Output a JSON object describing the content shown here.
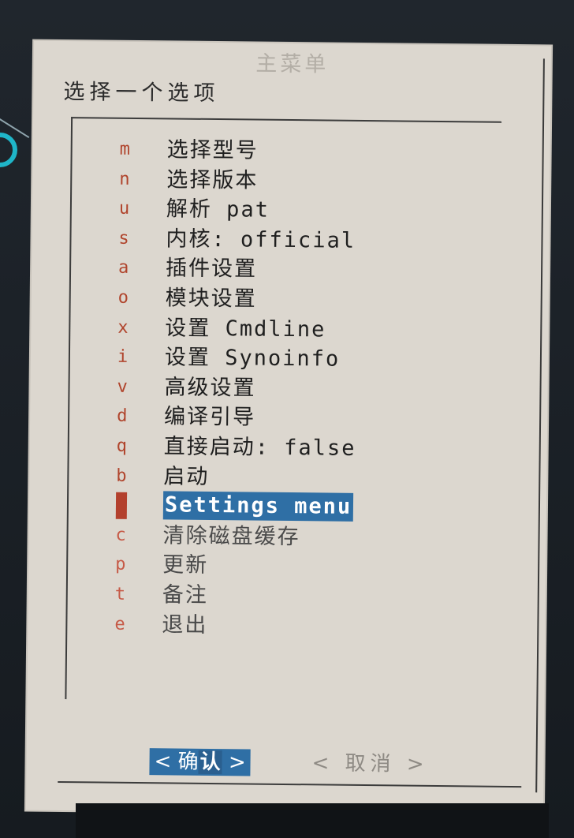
{
  "window": {
    "title": "主菜单",
    "prompt": "选择一个选项"
  },
  "menu": {
    "items": [
      {
        "key": "m",
        "label": "选择型号"
      },
      {
        "key": "n",
        "label": "选择版本"
      },
      {
        "key": "u",
        "label": "解析 pat"
      },
      {
        "key": "s",
        "label": "内核: official"
      },
      {
        "key": "a",
        "label": "插件设置"
      },
      {
        "key": "o",
        "label": "模块设置"
      },
      {
        "key": "x",
        "label": "设置 Cmdline"
      },
      {
        "key": "i",
        "label": "设置 Synoinfo"
      },
      {
        "key": "v",
        "label": "高级设置"
      },
      {
        "key": "d",
        "label": "编译引导"
      },
      {
        "key": "q",
        "label": "直接启动: false"
      },
      {
        "key": "b",
        "label": "启动"
      },
      {
        "key": "",
        "label": "Settings menu",
        "selected": true
      },
      {
        "key": "c",
        "label": "清除磁盘缓存"
      },
      {
        "key": "p",
        "label": "更新"
      },
      {
        "key": "t",
        "label": "备注"
      },
      {
        "key": "e",
        "label": "退出"
      }
    ]
  },
  "buttons": {
    "ok": {
      "left": "<",
      "hot": "确",
      "rest": "认",
      "right": ">"
    },
    "cancel": "< 取消 >"
  },
  "colors": {
    "dialog_bg": "#dcd7cf",
    "hotkey": "#b0442c",
    "selection_bg": "#2f6fa5",
    "selection_text": "#ffffff",
    "accent_ring": "#1fb5c8"
  }
}
